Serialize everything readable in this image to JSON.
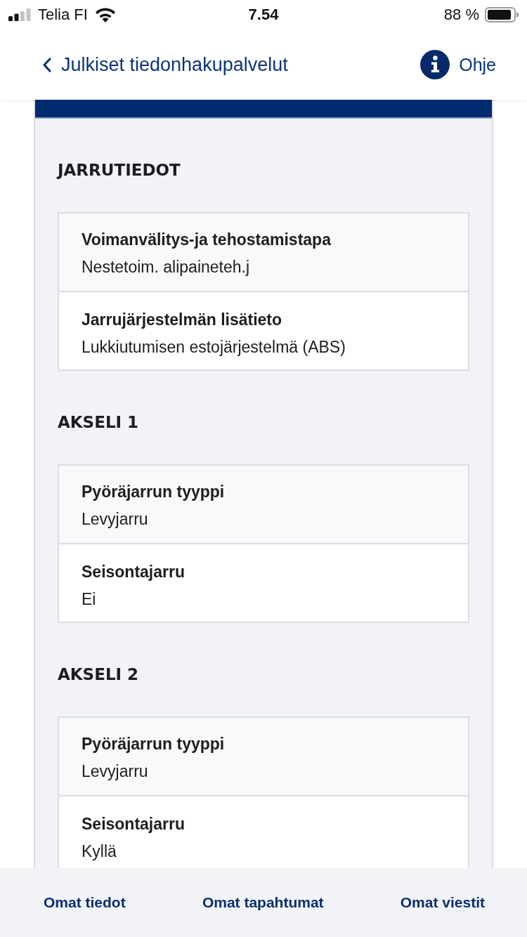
{
  "status_bar": {
    "carrier": "Telia FI",
    "time": "7.54",
    "battery": "88 %"
  },
  "nav": {
    "back_link": "Julkiset tiedonhakupalvelut",
    "help": "Ohje"
  },
  "sections": [
    {
      "title": "JARRUTIEDOT",
      "rows": [
        {
          "label": "Voimanvälitys-ja tehostamistapa",
          "value": "Nestetoim. alipaineteh.j"
        },
        {
          "label": "Jarrujärjestelmän lisätieto",
          "value": "Lukkiutumisen estojärjestelmä (ABS)"
        }
      ]
    },
    {
      "title": "AKSELI 1",
      "rows": [
        {
          "label": "Pyöräjarrun tyyppi",
          "value": "Levyjarru"
        },
        {
          "label": "Seisontajarru",
          "value": "Ei"
        }
      ]
    },
    {
      "title": "AKSELI 2",
      "rows": [
        {
          "label": "Pyöräjarrun tyyppi",
          "value": "Levyjarru"
        },
        {
          "label": "Seisontajarru",
          "value": "Kyllä"
        }
      ]
    }
  ],
  "bottom_nav": [
    {
      "label": "Omat tiedot"
    },
    {
      "label": "Omat tapahtumat"
    },
    {
      "label": "Omat viestit"
    }
  ]
}
